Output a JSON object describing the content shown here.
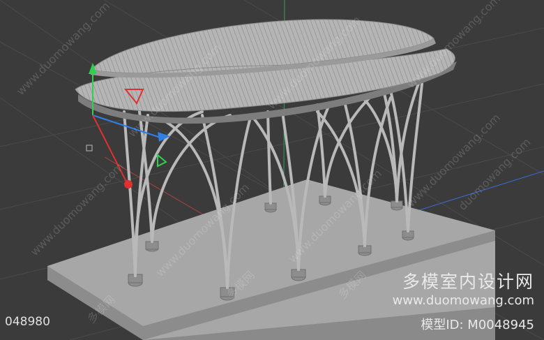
{
  "viewport": {
    "background": "#3b3b3b",
    "grid_color": "#4a4a4a",
    "model_color": "#a9a9a9"
  },
  "watermark": {
    "site": "www.duomowang.com",
    "site_short": "duomowang.com",
    "cn": "多模网"
  },
  "brand": {
    "name_cn": "多模室内设计网",
    "url": "www.duomowang.com",
    "model_id": "模型ID: M0048945"
  },
  "frame_number": "048980",
  "gizmo": {
    "x_color": "#e03030",
    "y_color": "#30d050",
    "z_color": "#2f7fe6"
  }
}
